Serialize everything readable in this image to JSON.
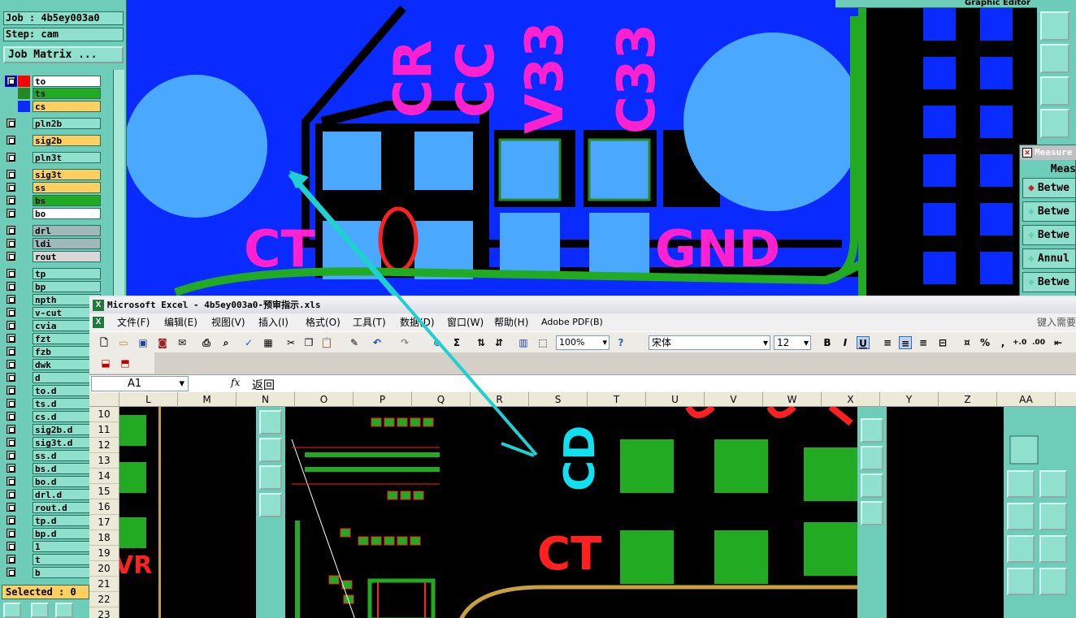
{
  "left_panel": {
    "job": "Job : 4b5ey003a0",
    "step": "Step: cam",
    "job_matrix": "Job Matrix ...",
    "layers": [
      {
        "name": "to",
        "color": "#ffffff",
        "c1": "#0000ff",
        "c2": "#ff0000"
      },
      {
        "name": "ts",
        "color": "#22aa22",
        "c1": "#6ecdb8",
        "c2": "#228822"
      },
      {
        "name": "cs",
        "color": "#ffd060",
        "c1": "#6ecdb8",
        "c2": "#0a2bff"
      },
      {
        "name": "pln2b",
        "color": "#8fe0cc"
      },
      {
        "name": "sig2b",
        "color": "#ffd060"
      },
      {
        "name": "pln3t",
        "color": "#8fe0cc"
      },
      {
        "name": "sig3t",
        "color": "#ffd060"
      },
      {
        "name": "ss",
        "color": "#ffd060"
      },
      {
        "name": "bs",
        "color": "#22aa22"
      },
      {
        "name": "bo",
        "color": "#ffffff"
      },
      {
        "name": "drl",
        "color": "#a0b8b8"
      },
      {
        "name": "ldi",
        "color": "#a0b8b8"
      },
      {
        "name": "rout",
        "color": "#d8d8d8"
      },
      {
        "name": "tp",
        "color": "#8fe0cc"
      },
      {
        "name": "bp",
        "color": "#8fe0cc"
      },
      {
        "name": "npth",
        "color": "#8fe0cc"
      },
      {
        "name": "v-cut",
        "color": "#8fe0cc"
      },
      {
        "name": "cvia",
        "color": "#8fe0cc"
      },
      {
        "name": "fzt",
        "color": "#8fe0cc"
      },
      {
        "name": "fzb",
        "color": "#8fe0cc"
      },
      {
        "name": "dwk",
        "color": "#8fe0cc"
      },
      {
        "name": "d",
        "color": "#8fe0cc"
      },
      {
        "name": "to.d",
        "color": "#8fe0cc"
      },
      {
        "name": "ts.d",
        "color": "#8fe0cc"
      },
      {
        "name": "cs.d",
        "color": "#8fe0cc"
      },
      {
        "name": "sig2b.d",
        "color": "#8fe0cc"
      },
      {
        "name": "sig3t.d",
        "color": "#8fe0cc"
      },
      {
        "name": "ss.d",
        "color": "#8fe0cc"
      },
      {
        "name": "bs.d",
        "color": "#8fe0cc"
      },
      {
        "name": "bo.d",
        "color": "#8fe0cc"
      },
      {
        "name": "drl.d",
        "color": "#8fe0cc"
      },
      {
        "name": "rout.d",
        "color": "#8fe0cc"
      },
      {
        "name": "tp.d",
        "color": "#8fe0cc"
      },
      {
        "name": "bp.d",
        "color": "#8fe0cc"
      },
      {
        "name": "1",
        "color": "#8fe0cc"
      },
      {
        "name": "t",
        "color": "#8fe0cc"
      },
      {
        "name": "b",
        "color": "#8fe0cc"
      }
    ],
    "selected": "Selected : 0"
  },
  "top_right_title": "Graphic Editor",
  "measure": {
    "title": "Measure",
    "header": "Meas",
    "items": [
      "Betwe",
      "Betwe",
      "Betwe",
      "Annul",
      "Betwe"
    ]
  },
  "canvas_labels": {
    "cr": "CR",
    "cc": "CC",
    "v33": "V33",
    "c33": "C33",
    "ct": "CT",
    "gnd": "GND"
  },
  "excel": {
    "title": "Microsoft Excel - 4b5ey003a0-预审指示.xls",
    "help_hint": "键入需要",
    "menu": [
      "文件(F)",
      "编辑(E)",
      "视图(V)",
      "插入(I)",
      "格式(O)",
      "工具(T)",
      "数据(D)",
      "窗口(W)",
      "帮助(H)",
      "Adobe PDF(B)"
    ],
    "zoom": "100%",
    "font": "宋体",
    "font_size": "12",
    "name_box": "A1",
    "fx": "fx",
    "formula": "返回",
    "columns": [
      "L",
      "M",
      "N",
      "O",
      "P",
      "Q",
      "R",
      "S",
      "T",
      "U",
      "V",
      "W",
      "X",
      "Y",
      "Z",
      "AA"
    ],
    "rows": [
      "10",
      "11",
      "12",
      "13",
      "14",
      "15",
      "16",
      "17",
      "18",
      "19",
      "20",
      "21",
      "22",
      "23"
    ],
    "grid_labels": {
      "cd": "CD",
      "ct": "CT",
      "vr": "VR"
    }
  }
}
